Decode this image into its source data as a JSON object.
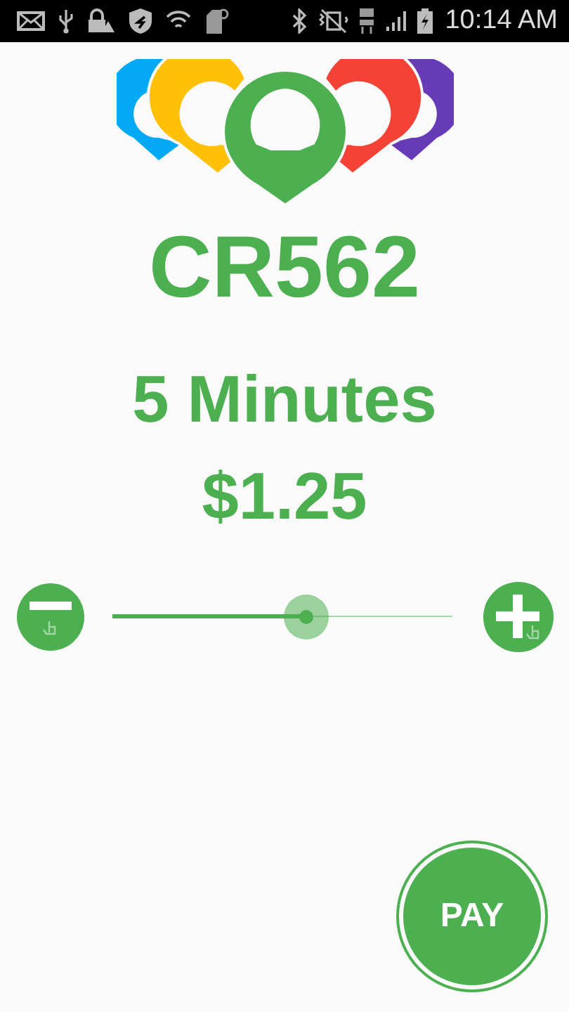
{
  "status_bar": {
    "time": "10:14 AM"
  },
  "zone": "CR562",
  "duration": "5 Minutes",
  "price": "$1.25",
  "slider": {
    "level": 0.57
  },
  "pay_button": "PAY"
}
